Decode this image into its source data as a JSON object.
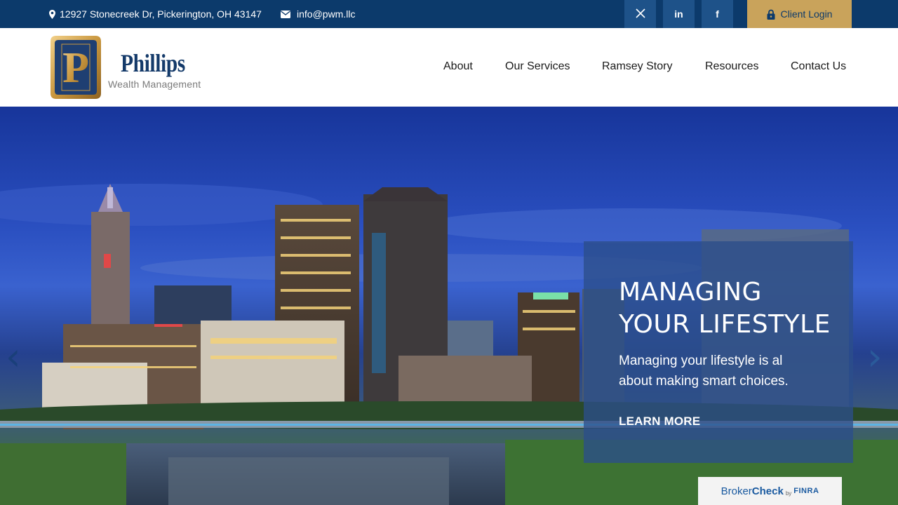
{
  "topbar": {
    "address": "12927 Stonecreek Dr, Pickerington, OH 43147",
    "email": "info@pwm.llc",
    "social": [
      {
        "icon": "x-twitter-icon",
        "label": "𝕏"
      },
      {
        "icon": "linkedin-icon",
        "label": "in"
      },
      {
        "icon": "facebook-icon",
        "label": "f"
      }
    ],
    "client_login": "Client Login"
  },
  "header": {
    "logo": {
      "monogram": "P",
      "name": "Phillips",
      "subtitle": "Wealth Management"
    },
    "nav": [
      "About",
      "Our Services",
      "Ramsey Story",
      "Resources",
      "Contact Us"
    ]
  },
  "hero": {
    "title_line1": "MANAGING",
    "title_line2": "YOUR LIFESTYLE",
    "text_line1": "Managing your lifestyle is al",
    "text_line2": "about making smart choices.",
    "cta": "LEARN MORE",
    "prev_arrow": "‹",
    "next_arrow": "›"
  },
  "brokercheck": {
    "broker": "Broker",
    "check": "Check",
    "by": "by",
    "finra": "FINRA"
  },
  "colors": {
    "topbar": "#0c3a6b",
    "social_bg": "#1e5289",
    "accent_gold": "#c9a35b",
    "brand_navy": "#143a6a"
  }
}
